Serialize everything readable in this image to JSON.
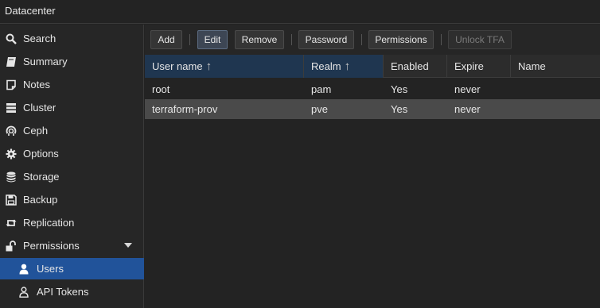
{
  "header": {
    "title": "Datacenter"
  },
  "sidebar": {
    "items": [
      {
        "label": "Search",
        "icon": "search-icon"
      },
      {
        "label": "Summary",
        "icon": "book-icon"
      },
      {
        "label": "Notes",
        "icon": "note-icon"
      },
      {
        "label": "Cluster",
        "icon": "server-icon"
      },
      {
        "label": "Ceph",
        "icon": "ceph-icon"
      },
      {
        "label": "Options",
        "icon": "gear-icon"
      },
      {
        "label": "Storage",
        "icon": "database-icon"
      },
      {
        "label": "Backup",
        "icon": "floppy-icon"
      },
      {
        "label": "Replication",
        "icon": "retweet-icon"
      },
      {
        "label": "Permissions",
        "icon": "unlock-icon"
      },
      {
        "label": "Users",
        "icon": "user-icon"
      },
      {
        "label": "API Tokens",
        "icon": "user-outline-icon"
      }
    ]
  },
  "toolbar": {
    "add": "Add",
    "edit": "Edit",
    "remove": "Remove",
    "password": "Password",
    "permissions": "Permissions",
    "unlock_tfa": "Unlock TFA"
  },
  "table": {
    "columns": [
      "User name",
      "Realm",
      "Enabled",
      "Expire",
      "Name"
    ],
    "sort_arrow": "↑",
    "rows": [
      [
        "root",
        "pam",
        "Yes",
        "never",
        ""
      ],
      [
        "terraform-prov",
        "pve",
        "Yes",
        "never",
        ""
      ]
    ]
  },
  "colors": {
    "background": "#232323",
    "active_nav": "#21539a",
    "selected_row": "#4a4a4a",
    "sorted_header": "#1f3650"
  }
}
